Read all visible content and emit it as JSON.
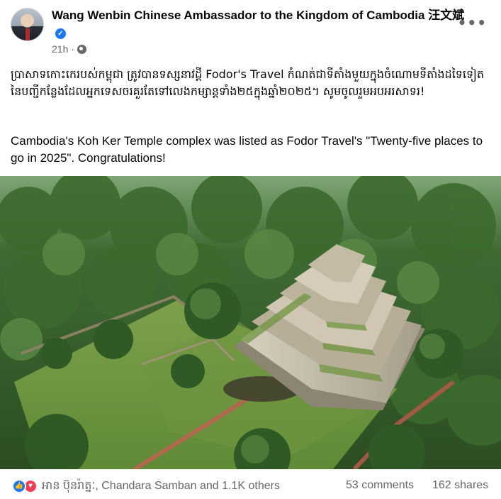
{
  "post": {
    "author": "Wang Wenbin Chinese Ambassador to the Kingdom of Cambodia 汪文斌",
    "timestamp": "21h",
    "audience_icon": "globe-icon",
    "more_icon": "more-options-icon",
    "text_khmer": "ប្រាសាទកោះកេរបស់កម្ពុជា ត្រូវបានទស្សនាវដ្តី Fodor's Travel កំណត់ជាទីតាំងមួយក្នុងចំណោមទីតាំងដទៃទៀតនៃបញ្ជីកន្លែងដែលអ្នកទេសចរគួរតែទៅលេងកម្សាន្តទាំង២៥ក្នុងឆ្នាំ២០២៥។ សូមចូលរួមអបអរសាទរ!",
    "text_english": "Cambodia's Koh Ker Temple complex was listed as Fodor Travel's \"Twenty-five places to go in 2025\". Congratulations!",
    "photo_alt": "Aerial view of Koh Ker pyramid temple in forest"
  },
  "footer": {
    "reaction_icons": [
      "like-icon",
      "love-icon"
    ],
    "reactors": "អាន ប៊ុនរ៉ាត្នៈ, Chandara Samban and 1.1K others",
    "comments": "53 comments",
    "shares": "162 shares"
  },
  "colors": {
    "accent": "#1877f2",
    "love": "#f33e58",
    "secondary_text": "#65676b"
  }
}
